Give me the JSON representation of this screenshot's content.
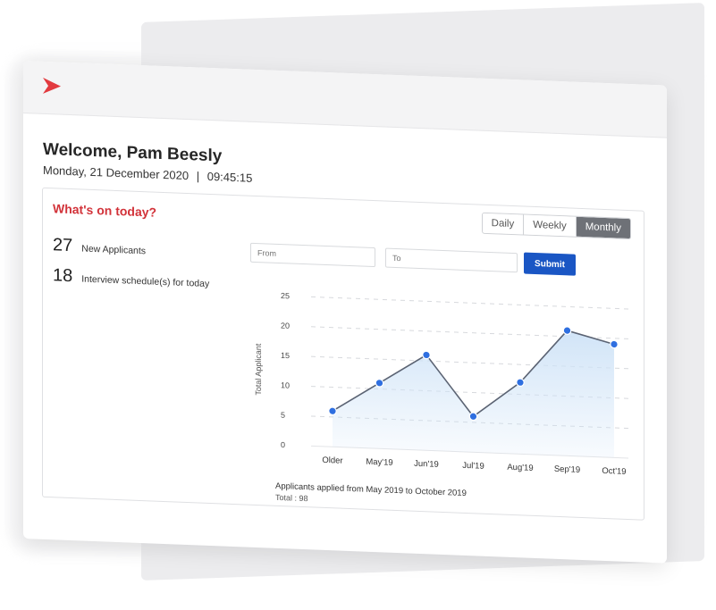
{
  "header": {
    "welcome": "Welcome, Pam Beesly",
    "date": "Monday, 21 December 2020",
    "separator": "|",
    "time": "09:45:15"
  },
  "panel": {
    "title": "What's on today?",
    "tabs": [
      {
        "label": "Daily",
        "active": false
      },
      {
        "label": "Weekly",
        "active": false
      },
      {
        "label": "Monthly",
        "active": true
      }
    ],
    "stats": [
      {
        "number": "27",
        "label": "New Applicants"
      },
      {
        "number": "18",
        "label": "Interview schedule(s) for today"
      }
    ],
    "from_placeholder": "From",
    "to_placeholder": "To",
    "submit_label": "Submit",
    "caption": "Applicants applied from May 2019 to October 2019",
    "total": "Total : 98"
  },
  "colors": {
    "accent": "#d2333a",
    "primary": "#1a56c4",
    "line": "#5b6373",
    "point": "#2f6fe0",
    "area": "#cfe3f7"
  },
  "chart_data": {
    "type": "area",
    "categories": [
      "Older",
      "May'19",
      "Jun'19",
      "Jul'19",
      "Aug'19",
      "Sep'19",
      "Oct'19"
    ],
    "values": [
      6,
      11,
      16,
      6,
      12,
      21,
      19
    ],
    "ylabel": "Total Applicant",
    "yticks": [
      0,
      5,
      10,
      15,
      20,
      25
    ],
    "ylim": [
      0,
      25
    ],
    "grid": true
  }
}
